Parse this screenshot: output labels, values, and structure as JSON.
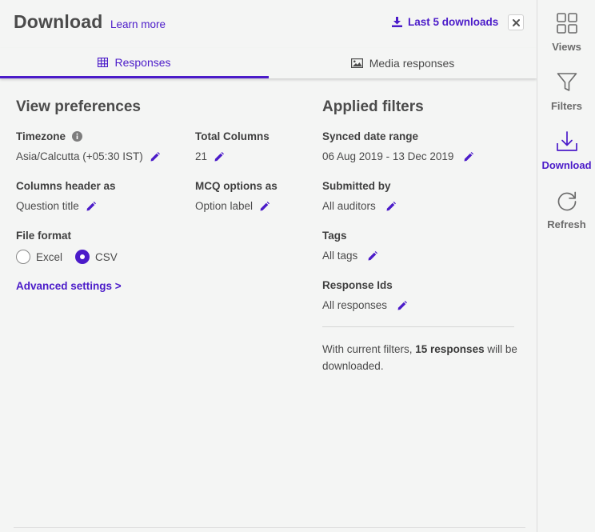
{
  "colors": {
    "accent": "#4b1bc9",
    "text": "#4b4b4b",
    "background": "#f4f5f4"
  },
  "header": {
    "title": "Download",
    "learn_more": "Learn more",
    "last_downloads": "Last 5 downloads",
    "close_icon": "close-icon"
  },
  "tabs": [
    {
      "label": "Responses",
      "icon": "table-icon",
      "active": true
    },
    {
      "label": "Media responses",
      "icon": "image-icon",
      "active": false
    }
  ],
  "view_preferences": {
    "title": "View preferences",
    "timezone": {
      "label": "Timezone",
      "value": "Asia/Calcutta (+05:30 IST)"
    },
    "total_columns": {
      "label": "Total Columns",
      "value": "21"
    },
    "columns_header": {
      "label": "Columns header as",
      "value": "Question title"
    },
    "mcq_options": {
      "label": "MCQ options as",
      "value": "Option label"
    },
    "file_format": {
      "label": "File format",
      "options": [
        "Excel",
        "CSV"
      ],
      "selected": "CSV"
    },
    "advanced": "Advanced settings >"
  },
  "applied_filters": {
    "title": "Applied filters",
    "date_range": {
      "label": "Synced date range",
      "value": "06 Aug 2019 - 13 Dec 2019"
    },
    "submitted_by": {
      "label": "Submitted by",
      "value": "All auditors"
    },
    "tags": {
      "label": "Tags",
      "value": "All tags"
    },
    "response_ids": {
      "label": "Response Ids",
      "value": "All responses"
    },
    "summary_prefix": "With current filters, ",
    "summary_count": "15 responses",
    "summary_suffix": " will be downloaded."
  },
  "sidebar": {
    "items": [
      {
        "label": "Views",
        "icon": "grid-icon",
        "active": false
      },
      {
        "label": "Filters",
        "icon": "funnel-icon",
        "active": false
      },
      {
        "label": "Download",
        "icon": "download-icon",
        "active": true
      },
      {
        "label": "Refresh",
        "icon": "refresh-icon",
        "active": false
      }
    ]
  }
}
